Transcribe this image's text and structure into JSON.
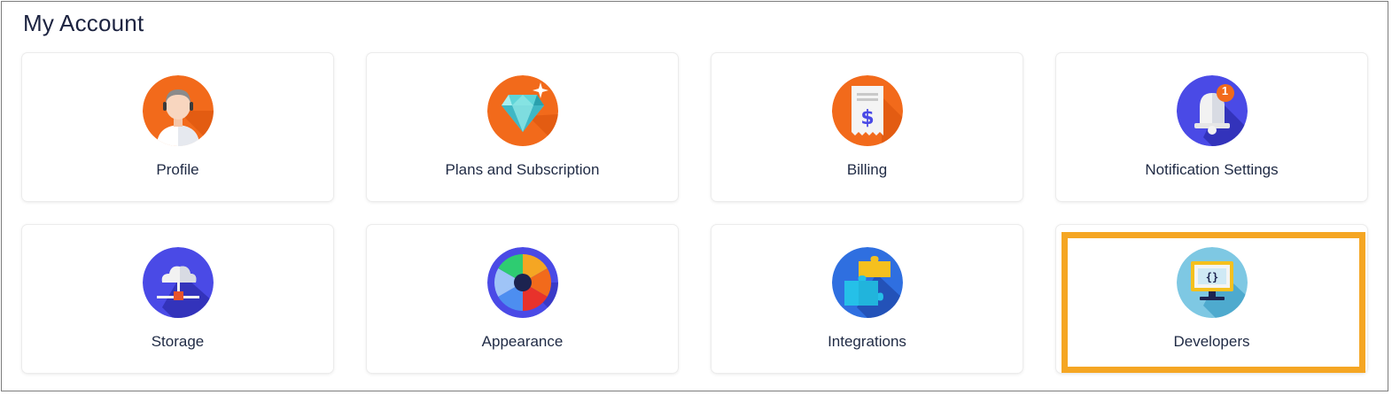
{
  "page": {
    "title": "My Account"
  },
  "cards": [
    {
      "label": "Profile",
      "icon": "profile-avatar-icon",
      "color": "#f26a1b"
    },
    {
      "label": "Plans and Subscription",
      "icon": "diamond-icon",
      "color": "#f26a1b"
    },
    {
      "label": "Billing",
      "icon": "receipt-icon",
      "color": "#f26a1b"
    },
    {
      "label": "Notification Settings",
      "icon": "bell-icon",
      "color": "#4a4ae6",
      "badge": "1"
    },
    {
      "label": "Storage",
      "icon": "cloud-network-icon",
      "color": "#4a4ae6"
    },
    {
      "label": "Appearance",
      "icon": "color-wheel-icon",
      "color": "#4a4ae6"
    },
    {
      "label": "Integrations",
      "icon": "puzzle-icon",
      "color": "#2f6fe0"
    },
    {
      "label": "Developers",
      "icon": "code-monitor-icon",
      "color": "#7ec8e3",
      "selected": true
    }
  ],
  "colors": {
    "highlight": "#f5a623",
    "text": "#1f2a44"
  }
}
